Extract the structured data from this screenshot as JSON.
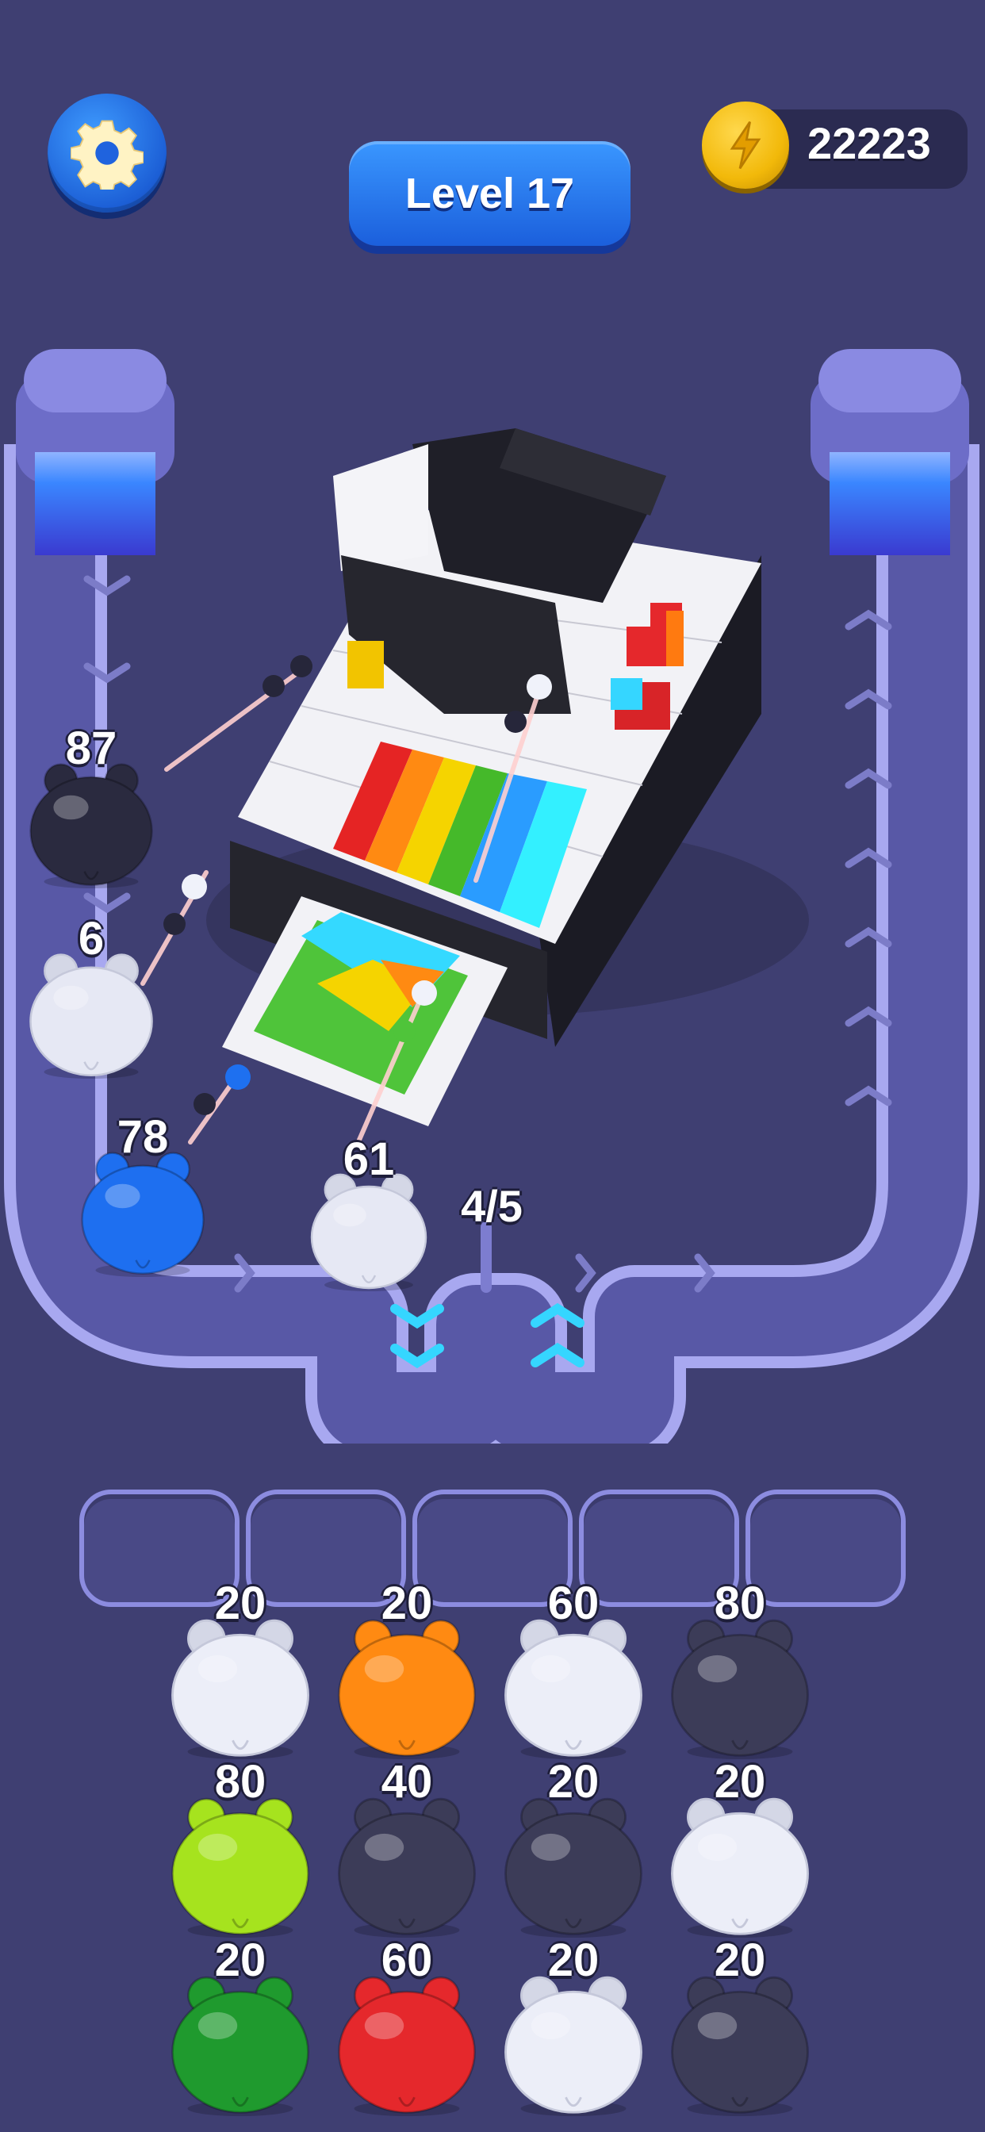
{
  "hud": {
    "level_label": "Level 17",
    "coins": "22223"
  },
  "colors": {
    "background": "#3f3f72",
    "track": "#5656a0",
    "accent_blue": "#1f6ef0",
    "coin": "#f2b90a"
  },
  "track": {
    "queue_count": "4/5"
  },
  "active_pigs": [
    {
      "count": "87",
      "color": "#2a2a3f"
    },
    {
      "count": "6",
      "color": "#e6e8f4"
    },
    {
      "count": "78",
      "color": "#1e6ff0"
    },
    {
      "count": "61",
      "color": "#e6e8f4"
    }
  ],
  "slots": [
    "",
    "",
    "",
    "",
    ""
  ],
  "pig_grid": [
    [
      {
        "count": "20",
        "color": "#eceef8"
      },
      {
        "count": "20",
        "color": "#ff8a12"
      },
      {
        "count": "60",
        "color": "#eceef8"
      },
      {
        "count": "80",
        "color": "#3c3c58"
      }
    ],
    [
      {
        "count": "80",
        "color": "#a6e31e"
      },
      {
        "count": "40",
        "color": "#3c3c58"
      },
      {
        "count": "20",
        "color": "#3c3c58"
      },
      {
        "count": "20",
        "color": "#eceef8"
      }
    ],
    [
      {
        "count": "20",
        "color": "#1f9a2e"
      },
      {
        "count": "60",
        "color": "#e5282c"
      },
      {
        "count": "20",
        "color": "#eceef8"
      },
      {
        "count": "20",
        "color": "#3c3c58"
      }
    ]
  ],
  "icons": {
    "settings": "gear-icon",
    "coin": "lightning-coin-icon"
  }
}
